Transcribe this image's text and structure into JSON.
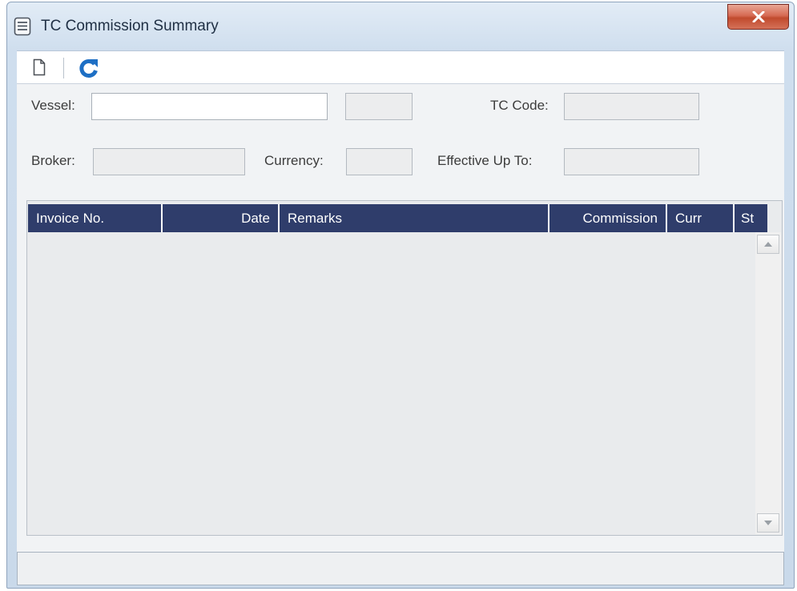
{
  "window": {
    "title": "TC Commission Summary",
    "close_glyph": "x"
  },
  "toolbar": {
    "new_icon": "new-document-icon",
    "refresh_icon": "refresh-icon"
  },
  "form": {
    "vessel_label": "Vessel:",
    "vessel_value": "",
    "vessel_code_value": "",
    "tc_code_label": "TC Code:",
    "tc_code_value": "",
    "broker_label": "Broker:",
    "broker_value": "",
    "currency_label": "Currency:",
    "currency_value": "",
    "effective_label": "Effective Up To:",
    "effective_value": ""
  },
  "grid": {
    "columns": [
      "Invoice No.",
      "Date",
      "Remarks",
      "Commission",
      "Curr",
      "St"
    ],
    "rows": []
  },
  "colors": {
    "header_bg": "#2f3d6b",
    "refresh_icon": "#1e6fc4",
    "close_button": "#c94f35"
  }
}
